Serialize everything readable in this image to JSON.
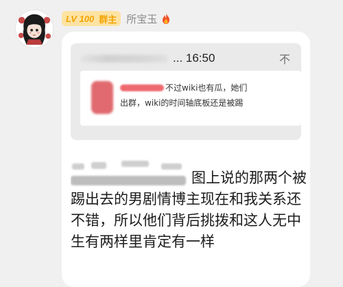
{
  "sender": {
    "level_badge": "LV 100",
    "role_badge": "群主",
    "name": "所宝玉",
    "fire_icon": "fire-icon"
  },
  "avatar": {
    "icon": "cartoon-girl-avatar"
  },
  "quote": {
    "time": "... 16:50",
    "close_icon": "不",
    "image": {
      "line1": "不过wiki也有瓜，她们",
      "line2": "出群，wiki的时间轴底板还是被踢"
    }
  },
  "message": {
    "text": "图上说的那两个被踢出去的男剧情博主现在和我关系还不错，所以他们背后挑拨和这人无中生有两样里肯定有一样"
  },
  "colors": {
    "badge_bg": "#fde3a3",
    "badge_text": "#f2a300",
    "redaction": "#ef6a6f",
    "bubble_bg": "#ffffff",
    "quote_bg": "#eaeaea"
  }
}
